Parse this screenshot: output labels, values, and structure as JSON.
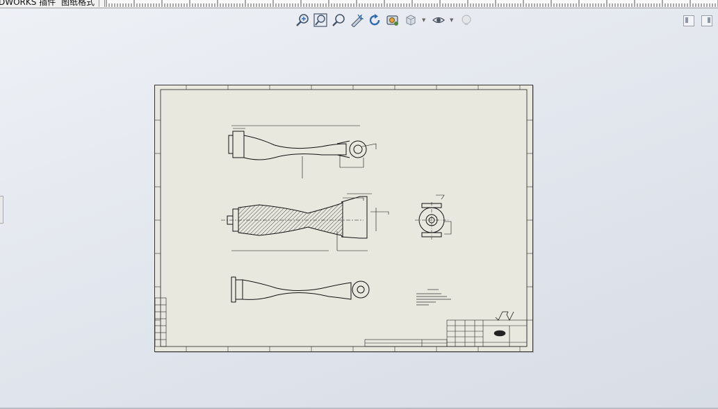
{
  "tabs": {
    "addins": "DWORKS 插件",
    "sheet_format": "图纸格式"
  },
  "toolbar": {
    "buttons": [
      {
        "name": "zoom-to-fit-icon",
        "icon": "magnifier-plus"
      },
      {
        "name": "zoom-to-area-icon",
        "icon": "magnifier-box"
      },
      {
        "name": "zoom-in-out-icon",
        "icon": "magnifier"
      },
      {
        "name": "select-icon",
        "icon": "arrow-wand"
      },
      {
        "name": "redraw-icon",
        "icon": "circular-arrow"
      },
      {
        "name": "apply-scene-icon",
        "icon": "scene"
      },
      {
        "name": "display-style-icon",
        "icon": "cube"
      },
      {
        "name": "hide-show-icon",
        "icon": "eye"
      },
      {
        "name": "view-settings-icon",
        "icon": "light"
      }
    ]
  },
  "colors": {
    "sheet_background": "#e8e8df",
    "line": "#000000",
    "canvas_background": "#e3e7ee"
  }
}
